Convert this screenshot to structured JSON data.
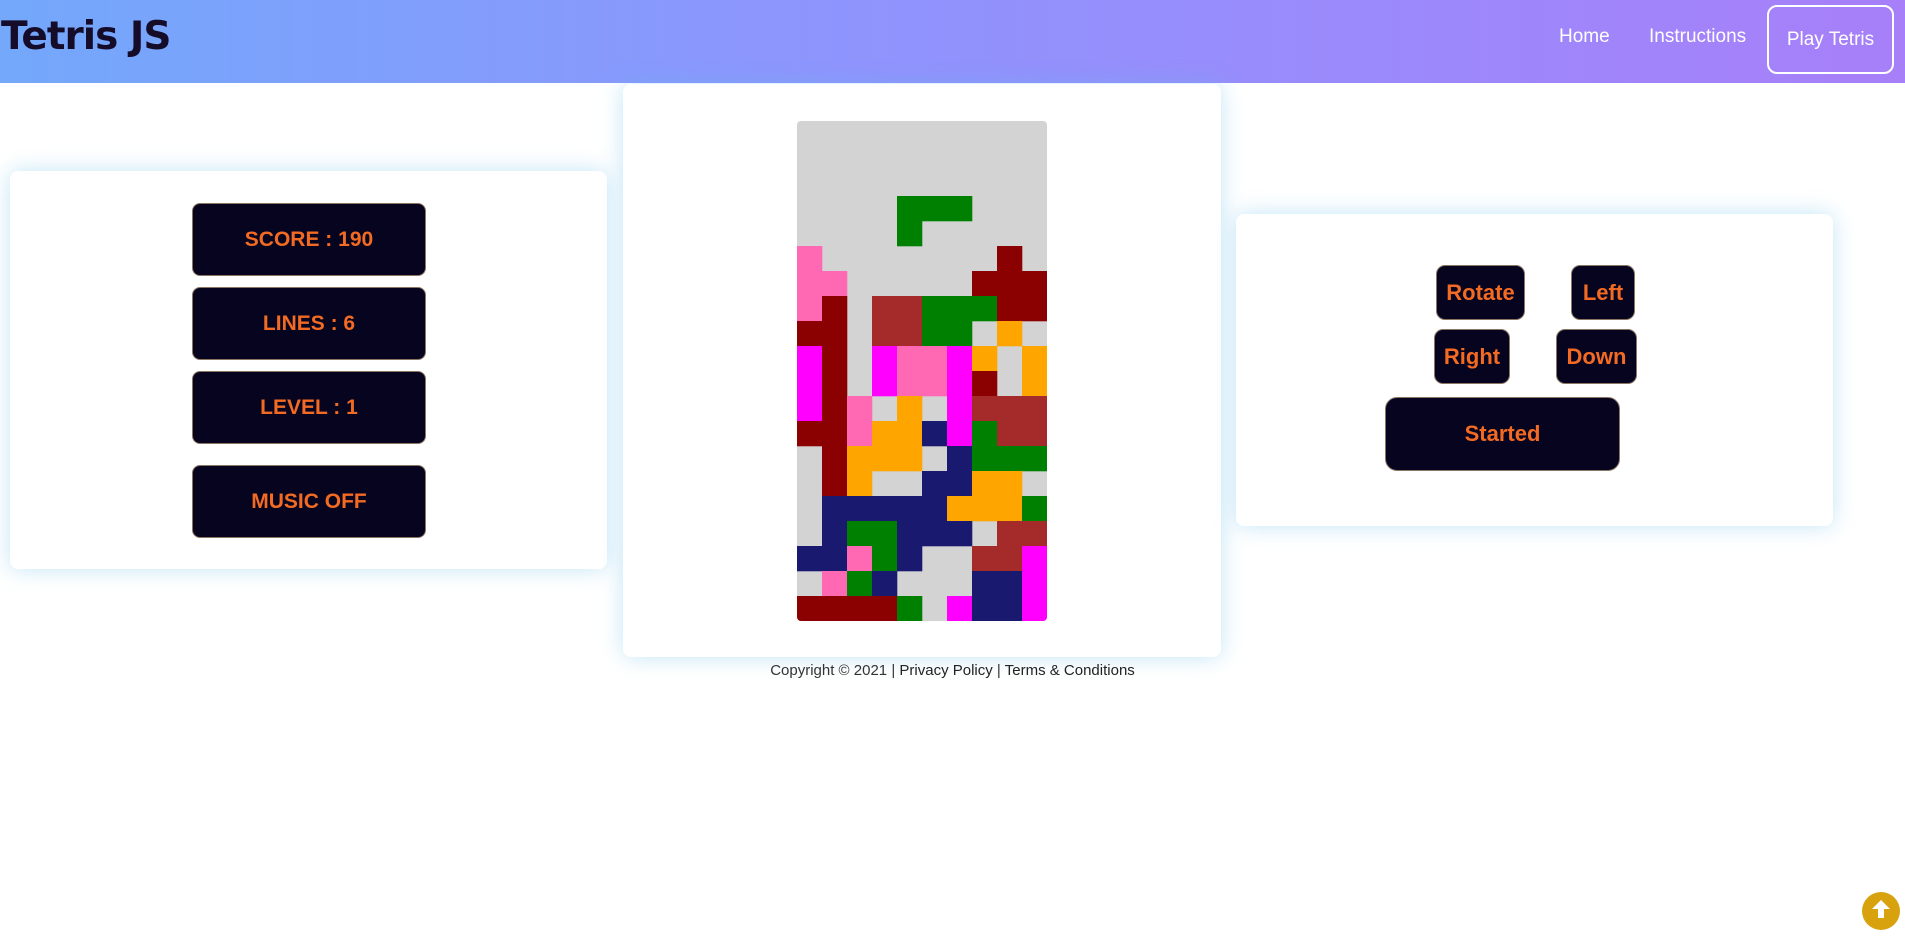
{
  "nav": {
    "brand": "Tetris JS",
    "links": [
      "Home",
      "Instructions"
    ],
    "play": "Play Tetris"
  },
  "stats": {
    "score": "SCORE : 190",
    "lines": "LINES : 6",
    "level": "LEVEL : 1",
    "music": "MUSIC OFF"
  },
  "controls": {
    "rotate": "Rotate",
    "left": "Left",
    "right": "Right",
    "down": "Down",
    "start": "Started"
  },
  "footer": {
    "copyright": "Copyright © 2021",
    "separator": "|",
    "privacy": "Privacy Policy",
    "terms": "Terms & Conditions"
  },
  "game": {
    "columns": 10,
    "rows": 20,
    "colors": {
      "g": "#008000",
      "r": "#8b0000",
      "p": "#ff69b4",
      "b": "#a52a2a",
      "o": "#ffa500",
      "m": "#ff00ff",
      "n": "#191970"
    },
    "grid": [
      "..........",
      "..........",
      "..........",
      "....ggg...",
      "....g.....",
      "p.......r.",
      "pp.....rrr",
      "pr.bbgggrr",
      "rr.bbgg.o.",
      "mr.mppmo.o",
      "mr.mppmr.o",
      "mrp.o.mbbb",
      "rrpoonmgbb",
      ".rooo.nggg",
      ".ro..nnoo.",
      ".nnnnnooog",
      ".nggnnn.bb",
      "nnpgn..bbm",
      ".pgn...nnm",
      "rrrrg.mnnm"
    ]
  },
  "icons": {
    "scroll_top": "arrow-up-icon"
  }
}
